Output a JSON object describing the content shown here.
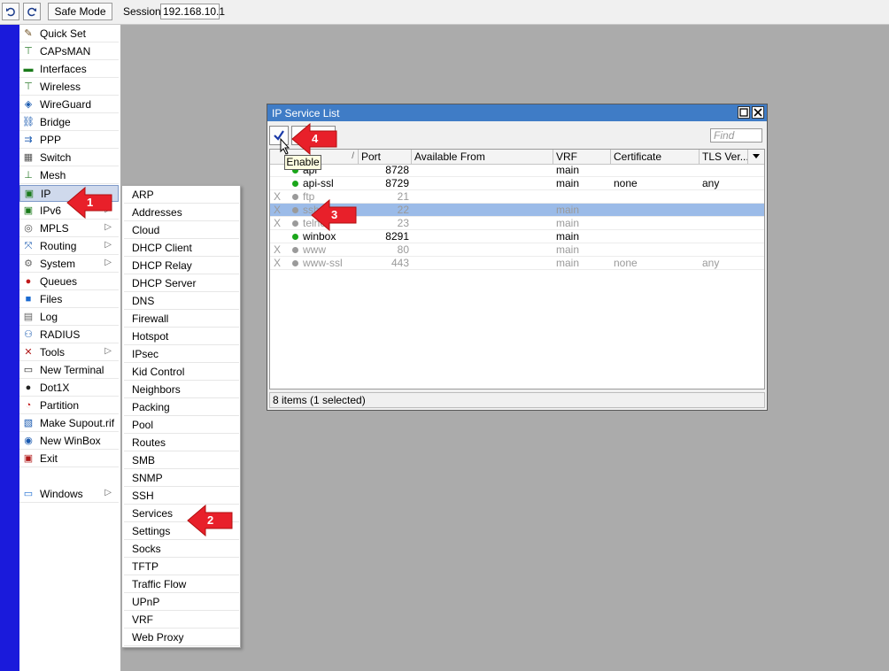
{
  "toolbar": {
    "undo_icon": "undo-icon",
    "redo_icon": "redo-icon",
    "safe_mode_label": "Safe Mode",
    "session_label": "Session:",
    "session_value": "192.168.10.1"
  },
  "sidebar": {
    "items": [
      {
        "label": "Quick Set",
        "icon": "wand-icon"
      },
      {
        "label": "CAPsMAN",
        "icon": "antenna-icon"
      },
      {
        "label": "Interfaces",
        "icon": "interfaces-icon"
      },
      {
        "label": "Wireless",
        "icon": "wireless-icon"
      },
      {
        "label": "WireGuard",
        "icon": "wireguard-icon"
      },
      {
        "label": "Bridge",
        "icon": "bridge-icon"
      },
      {
        "label": "PPP",
        "icon": "ppp-icon"
      },
      {
        "label": "Switch",
        "icon": "switch-icon"
      },
      {
        "label": "Mesh",
        "icon": "mesh-icon"
      },
      {
        "label": "IP",
        "icon": "ip-icon"
      },
      {
        "label": "IPv6",
        "icon": "ipv6-icon"
      },
      {
        "label": "MPLS",
        "icon": "mpls-icon"
      },
      {
        "label": "Routing",
        "icon": "routing-icon"
      },
      {
        "label": "System",
        "icon": "gear-icon"
      },
      {
        "label": "Queues",
        "icon": "queues-icon"
      },
      {
        "label": "Files",
        "icon": "folder-icon"
      },
      {
        "label": "Log",
        "icon": "log-icon"
      },
      {
        "label": "RADIUS",
        "icon": "radius-icon"
      },
      {
        "label": "Tools",
        "icon": "tools-icon"
      },
      {
        "label": "New Terminal",
        "icon": "terminal-icon"
      },
      {
        "label": "Dot1X",
        "icon": "dot1x-icon"
      },
      {
        "label": "Partition",
        "icon": "partition-icon"
      },
      {
        "label": "Make Supout.rif",
        "icon": "supout-icon"
      },
      {
        "label": "New WinBox",
        "icon": "winbox-icon"
      },
      {
        "label": "Exit",
        "icon": "exit-icon"
      },
      {
        "label": "Windows",
        "icon": "windows-icon"
      }
    ]
  },
  "submenu": {
    "items": [
      "ARP",
      "Addresses",
      "Cloud",
      "DHCP Client",
      "DHCP Relay",
      "DHCP Server",
      "DNS",
      "Firewall",
      "Hotspot",
      "IPsec",
      "Kid Control",
      "Neighbors",
      "Packing",
      "Pool",
      "Routes",
      "SMB",
      "SNMP",
      "SSH",
      "Services",
      "Settings",
      "Socks",
      "TFTP",
      "Traffic Flow",
      "UPnP",
      "VRF",
      "Web Proxy"
    ]
  },
  "window": {
    "title": "IP Service List",
    "find_placeholder": "Find",
    "tooltip": "Enable",
    "columns": [
      "",
      "",
      "Port",
      "Available From",
      "VRF",
      "Certificate",
      "TLS Ver..."
    ],
    "sort_indicator": "/",
    "rows": [
      {
        "flag": "",
        "name": "api",
        "port": "8728",
        "from": "",
        "vrf": "main",
        "cert": "",
        "tls": "",
        "enabled": true
      },
      {
        "flag": "",
        "name": "api-ssl",
        "port": "8729",
        "from": "",
        "vrf": "main",
        "cert": "none",
        "tls": "any",
        "enabled": true
      },
      {
        "flag": "X",
        "name": "ftp",
        "port": "21",
        "from": "",
        "vrf": "",
        "cert": "",
        "tls": "",
        "enabled": false
      },
      {
        "flag": "X",
        "name": "ssh",
        "port": "22",
        "from": "",
        "vrf": "main",
        "cert": "",
        "tls": "",
        "enabled": false
      },
      {
        "flag": "X",
        "name": "telnet",
        "port": "23",
        "from": "",
        "vrf": "main",
        "cert": "",
        "tls": "",
        "enabled": false
      },
      {
        "flag": "",
        "name": "winbox",
        "port": "8291",
        "from": "",
        "vrf": "main",
        "cert": "",
        "tls": "",
        "enabled": true
      },
      {
        "flag": "X",
        "name": "www",
        "port": "80",
        "from": "",
        "vrf": "main",
        "cert": "",
        "tls": "",
        "enabled": false
      },
      {
        "flag": "X",
        "name": "www-ssl",
        "port": "443",
        "from": "",
        "vrf": "main",
        "cert": "none",
        "tls": "any",
        "enabled": false
      }
    ],
    "status": "8 items (1 selected)"
  },
  "callouts": [
    "1",
    "2",
    "3",
    "4"
  ],
  "colors": {
    "accent_blue": "#3f7cc6",
    "strip": "#1a1adb",
    "enabled_dot": "#1aa61a",
    "disabled_dot": "#9a9a9a",
    "selected_row": "#9bbbe8",
    "callout_red": "#e8202a"
  }
}
